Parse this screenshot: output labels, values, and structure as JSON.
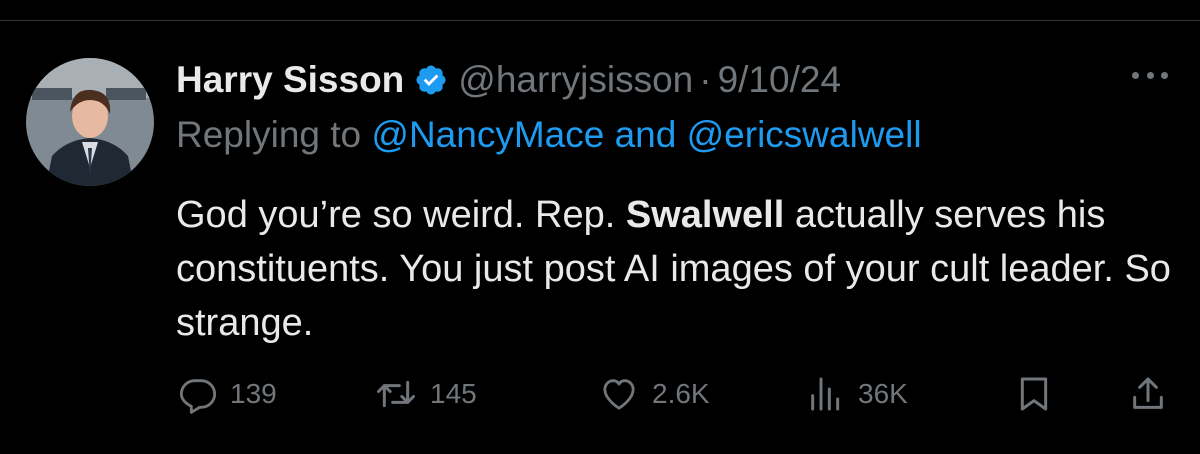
{
  "tweet": {
    "author_name": "Harry Sisson",
    "handle": "@harryjsisson",
    "separator": "·",
    "date": "9/10/24",
    "replying_prefix": "Replying to",
    "reply_to_1": "@NancyMace",
    "reply_joiner": "and",
    "reply_to_2": "@ericswalwell",
    "text_part1": "God you’re so weird. Rep.",
    "text_bold": "Swalwell",
    "text_part2": "actually serves his constituents. You just post AI images of your cult leader. So strange."
  },
  "stats": {
    "replies": "139",
    "retweets": "145",
    "likes": "2.6K",
    "views": "36K"
  },
  "icons": {
    "verified": "verified-badge-icon",
    "more": "more-options-icon",
    "reply": "reply-icon",
    "retweet": "retweet-icon",
    "like": "heart-icon",
    "views": "views-icon",
    "bookmark": "bookmark-icon",
    "share": "share-icon"
  },
  "colors": {
    "background": "#000000",
    "text": "#e7e9ea",
    "muted": "#71767b",
    "link": "#1d9bf0"
  }
}
